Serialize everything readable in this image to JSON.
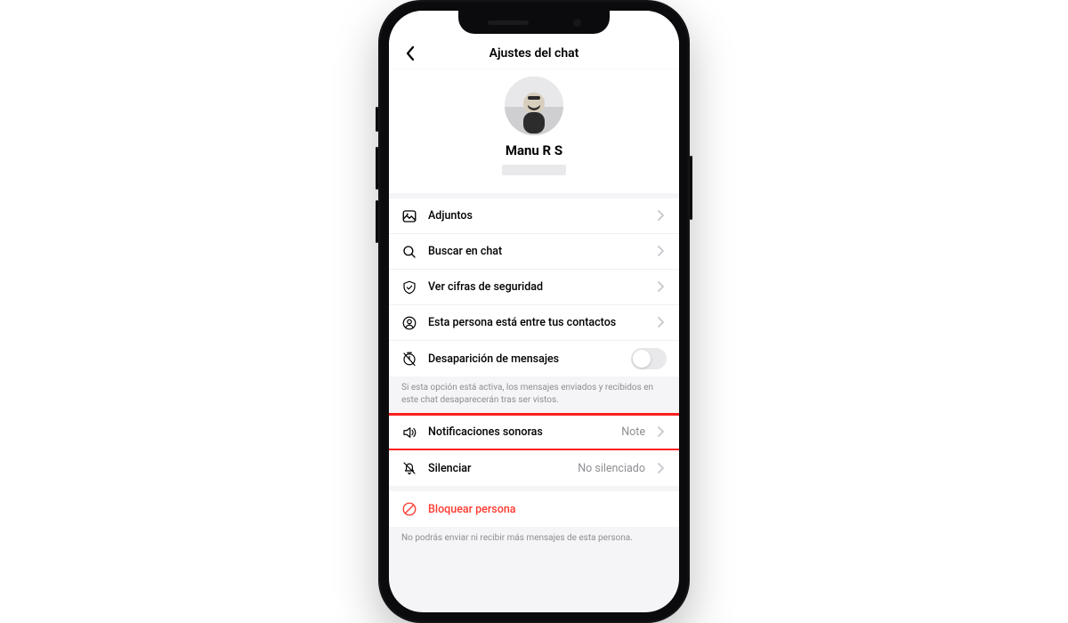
{
  "header": {
    "title": "Ajustes del chat"
  },
  "profile": {
    "name": "Manu R S"
  },
  "section1": {
    "attachments": "Adjuntos",
    "search": "Buscar en chat",
    "security": "Ver cifras de seguridad",
    "contacts": "Esta persona está entre tus contactos",
    "disappearing": "Desaparición de mensajes",
    "disappearing_help": "Si esta opción está activa, los mensajes enviados y recibidos en este chat desaparecerán tras ser vistos."
  },
  "section2": {
    "sound_label": "Notificaciones sonoras",
    "sound_value": "Note",
    "mute_label": "Silenciar",
    "mute_value": "No silenciado"
  },
  "section3": {
    "block_label": "Bloquear persona",
    "block_help": "No podrás enviar ni recibir más mensajes de esta persona."
  }
}
